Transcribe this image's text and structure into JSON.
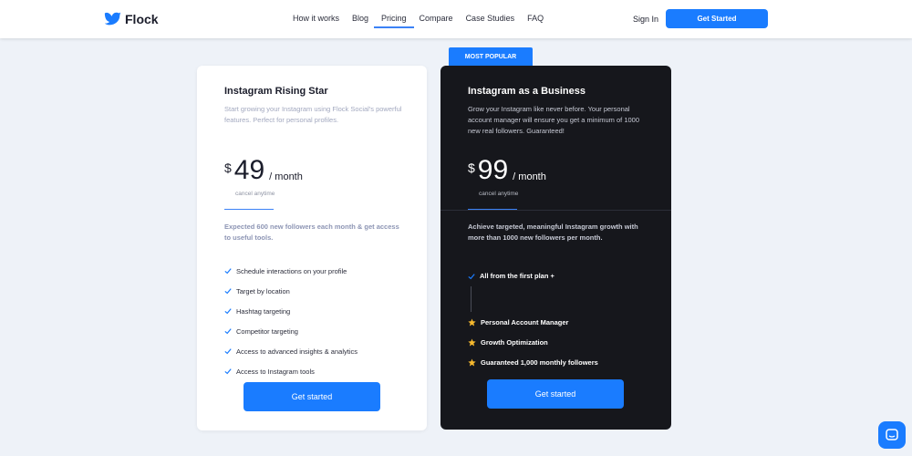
{
  "brand": {
    "name": "Flock",
    "accent": "#1a7cff",
    "dark_bg": "#16171c"
  },
  "nav": {
    "items": [
      {
        "label": "How it works"
      },
      {
        "label": "Blog"
      },
      {
        "label": "Pricing",
        "active": true
      },
      {
        "label": "Compare"
      },
      {
        "label": "Case Studies"
      },
      {
        "label": "FAQ"
      }
    ],
    "signin_label": "Sign In",
    "cta_label": "Get Started"
  },
  "plans": [
    {
      "title": "Instagram Rising Star",
      "description": "Start growing your Instagram using Flock Social's powerful features. Perfect for personal profiles.",
      "currency": "$",
      "price": "49",
      "period": "/ month",
      "cancel_note": "cancel anytime",
      "expectation": "Expected 600 new followers each month & get access to useful tools.",
      "features": [
        "Schedule interactions on your profile",
        "Target by location",
        "Hashtag targeting",
        "Competitor targeting",
        "Access to advanced insights & analytics",
        "Access to Instagram tools"
      ],
      "cta_label": "Get started"
    },
    {
      "badge": "MOST POPULAR",
      "title": "Instagram as a Business",
      "description": "Grow your Instagram like never before. Your personal account manager will ensure you get a minimum of 1000 new real followers. Guaranteed!",
      "currency": "$",
      "price": "99",
      "period": "/ month",
      "cancel_note": "cancel anytime",
      "expectation": "Achieve targeted, meaningful Instagram growth with more than 1000 new followers per month.",
      "base_feature": "All from the first plan +",
      "premium_features": [
        "Personal Account Manager",
        "Growth Optimization",
        "Guaranteed 1,000 monthly followers"
      ],
      "cta_label": "Get started"
    }
  ],
  "icons": {
    "logo": "bird-logo-icon",
    "check": "check-icon",
    "star": "star-icon",
    "chat": "chat-icon"
  }
}
